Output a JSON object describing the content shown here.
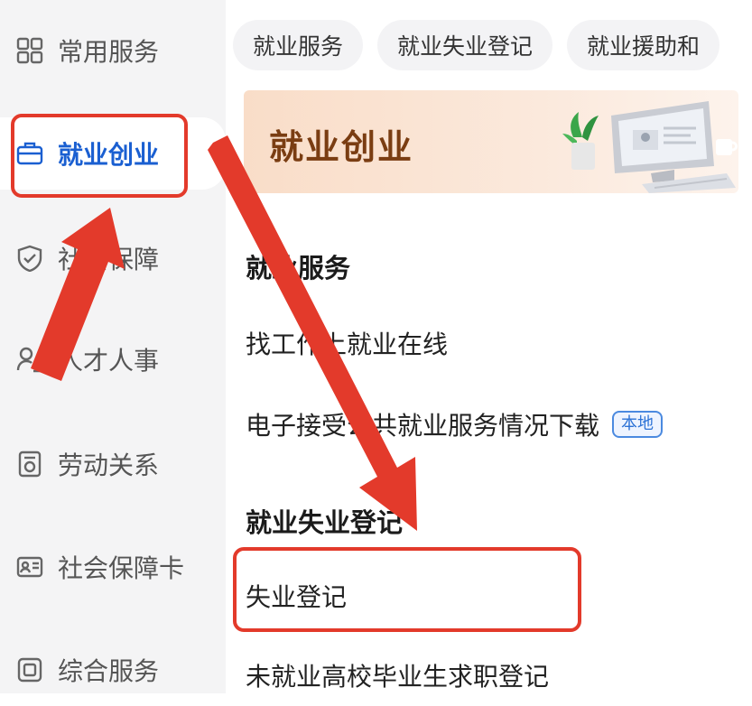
{
  "sidebar": {
    "items": [
      {
        "label": "常用服务",
        "icon": "grid-icon"
      },
      {
        "label": "就业创业",
        "icon": "briefcase-icon",
        "active": true
      },
      {
        "label": "社会保障",
        "icon": "shield-check-icon"
      },
      {
        "label": "人才人事",
        "icon": "person-list-icon"
      },
      {
        "label": "劳动关系",
        "icon": "document-seal-icon"
      },
      {
        "label": "社会保障卡",
        "icon": "id-card-icon"
      },
      {
        "label": "综合服务",
        "icon": "copy-stack-icon"
      }
    ]
  },
  "tabs": [
    "就业服务",
    "就业失业登记",
    "就业援助和"
  ],
  "banner": {
    "title": "就业创业"
  },
  "sections": [
    {
      "title": "就业服务",
      "items": [
        {
          "label": "找工作上就业在线"
        },
        {
          "label": "电子接受公共就业服务情况下载",
          "badge": "本地"
        }
      ]
    },
    {
      "title": "就业失业登记",
      "items": [
        {
          "label": "失业登记"
        },
        {
          "label": "未就业高校毕业生求职登记"
        }
      ]
    }
  ],
  "colors": {
    "accent": "#1a5fd1",
    "annotation_red": "#e33a2b",
    "banner_text": "#7a3d12"
  }
}
